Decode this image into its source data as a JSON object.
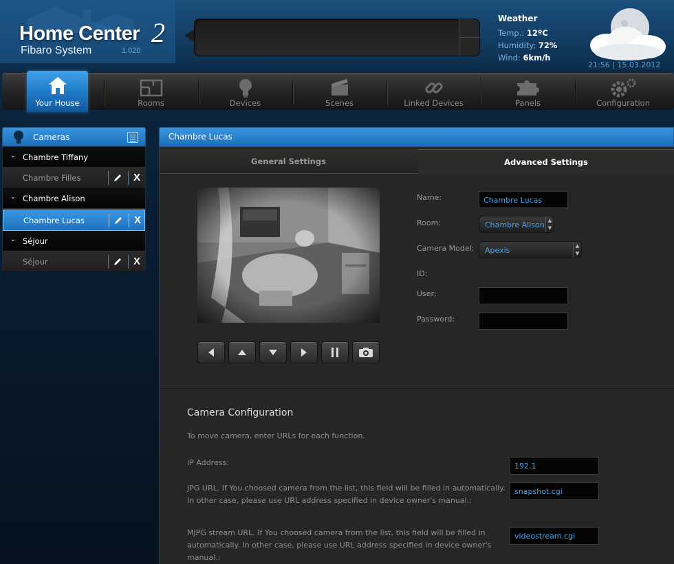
{
  "app": {
    "title": "Home Center",
    "title_number": "2",
    "subtitle": "Fibaro System",
    "version": "1.020"
  },
  "weather": {
    "title": "Weather",
    "temp_label": "Temp.:",
    "temp_value": "12ºC",
    "humidity_label": "Humidity:",
    "humidity_value": "72%",
    "wind_label": "Wind:",
    "wind_value": "6km/h",
    "datetime": "21:56 | 15.03.2012"
  },
  "nav": {
    "items": [
      {
        "label": "Your House",
        "icon": "house-icon",
        "active": true
      },
      {
        "label": "Rooms",
        "icon": "rooms-icon"
      },
      {
        "label": "Devices",
        "icon": "bulb-icon"
      },
      {
        "label": "Scenes",
        "icon": "clapperboard-icon"
      },
      {
        "label": "Linked Devices",
        "icon": "link-icon"
      },
      {
        "label": "Panels",
        "icon": "puzzle-icon"
      },
      {
        "label": "Configuration",
        "icon": "gears-icon"
      }
    ]
  },
  "sidebar": {
    "title": "Cameras",
    "groups": [
      {
        "name": "Chambre Tiffany",
        "cameras": [
          {
            "name": "Chambre Filles"
          }
        ]
      },
      {
        "name": "Chambre Alison",
        "cameras": [
          {
            "name": "Chambre Lucas",
            "selected": true
          }
        ]
      },
      {
        "name": "Séjour",
        "cameras": [
          {
            "name": "Séjour"
          }
        ]
      }
    ],
    "delete_label": "X"
  },
  "main": {
    "title": "Chambre Lucas",
    "tabs": {
      "general": "General Settings",
      "advanced": "Advanced Settings"
    },
    "form": {
      "name_label": "Name:",
      "name_value": "Chambre Lucas",
      "room_label": "Room:",
      "room_value": "Chambre Alison",
      "model_label": "Camera Model:",
      "model_value": "Apexis",
      "id_label": "ID:",
      "user_label": "User:",
      "user_value": "",
      "password_label": "Password:",
      "password_value": ""
    },
    "ptz_buttons": [
      "left-arrow-icon",
      "up-arrow-icon",
      "down-arrow-icon",
      "right-arrow-icon",
      "pause-icon",
      "camera-icon"
    ],
    "config": {
      "title": "Camera Configuration",
      "intro": "To move camera, enter URLs for each function.",
      "ip_label": "IP Address:",
      "ip_value": "192.1",
      "jpg_label": "JPG URL. If You choosed camera from the list, this field will be filled in automatically. In other case, please use URL address specified in device owner's manual.:",
      "jpg_value": "snapshot.cgi",
      "mjpg_label": "MJPG stream URL. If You choosed camera from the list, this field will be filled in automatically. In other case, please use URL address specified in device owner's manual.:",
      "mjpg_value": "videostream.cgi"
    }
  },
  "colors": {
    "accent_blue": "#1f78c6",
    "input_text": "#4aa2ea",
    "panel_bg": "#262626"
  }
}
